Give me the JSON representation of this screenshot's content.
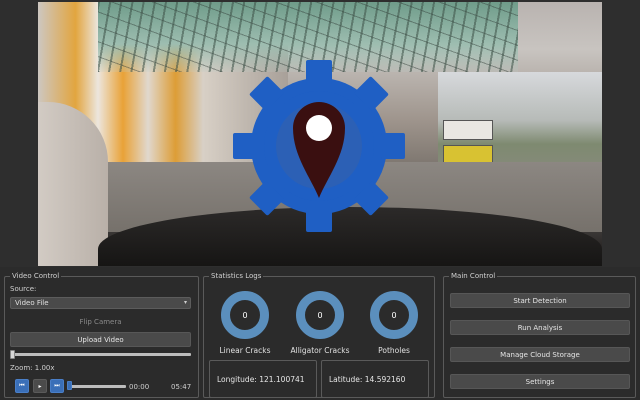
{
  "video_control": {
    "title": "Video Control",
    "source_label": "Source:",
    "source_value": "Video File",
    "flip_camera": "Flip Camera",
    "upload_video": "Upload Video",
    "zoom_label": "Zoom: 1.00x",
    "time_current": "00:00",
    "time_total": "05:47",
    "playback_progress": 0.0
  },
  "stats": {
    "title": "Statistics Logs",
    "counters": [
      {
        "label": "Linear Cracks",
        "value": "0"
      },
      {
        "label": "Alligator Cracks",
        "value": "0"
      },
      {
        "label": "Potholes",
        "value": "0"
      }
    ],
    "longitude": "Longitude: 121.100741",
    "latitude": "Latitude: 14.592160"
  },
  "main_control": {
    "title": "Main Control",
    "buttons": [
      "Start Detection",
      "Run Analysis",
      "Manage Cloud Storage",
      "Settings"
    ]
  },
  "colors": {
    "logo_gear": "#1f5fc4",
    "pin": "#3a0f10",
    "ring": "#5b8fbd"
  }
}
